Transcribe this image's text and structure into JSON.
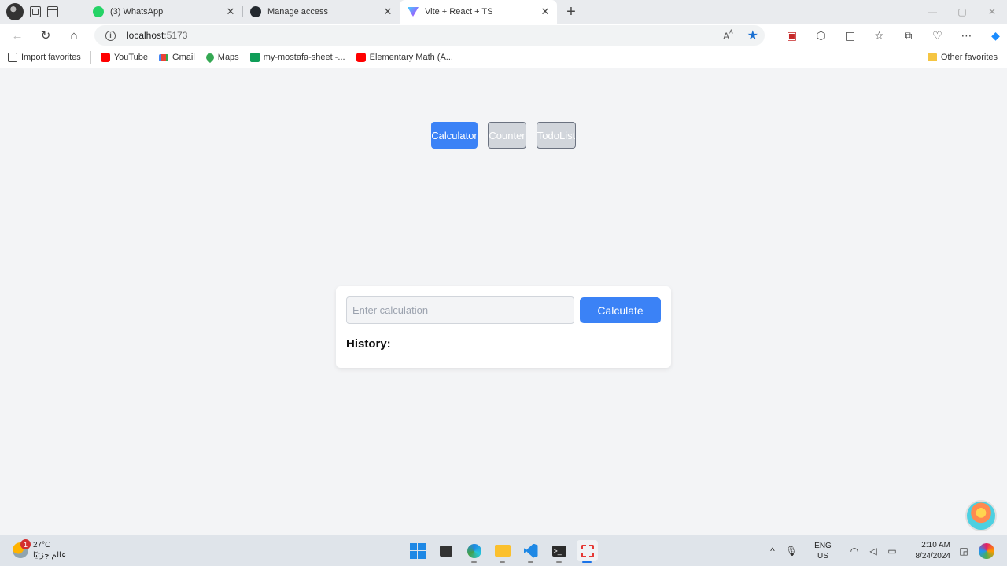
{
  "browser": {
    "tabs": [
      {
        "title": "(3) WhatsApp",
        "icon": "whatsapp-icon",
        "active": false
      },
      {
        "title": "Manage access",
        "icon": "github-icon",
        "active": false
      },
      {
        "title": "Vite + React + TS",
        "icon": "vite-icon",
        "active": true
      }
    ],
    "address": {
      "host": "localhost",
      "port": ":5173"
    },
    "bookmarks": [
      {
        "label": "Import favorites",
        "icon": "import-icon"
      },
      {
        "label": "YouTube",
        "icon": "youtube-icon"
      },
      {
        "label": "Gmail",
        "icon": "gmail-icon"
      },
      {
        "label": "Maps",
        "icon": "maps-icon"
      },
      {
        "label": "my-mostafa-sheet -...",
        "icon": "sheets-icon"
      },
      {
        "label": "Elementary Math (A...",
        "icon": "youtube-icon"
      }
    ],
    "other_favorites": "Other favorites"
  },
  "app": {
    "nav": [
      {
        "label": "Calculator",
        "active": true
      },
      {
        "label": "Counter",
        "active": false
      },
      {
        "label": "TodoList",
        "active": false
      }
    ],
    "calculator": {
      "input_value": "",
      "input_placeholder": "Enter calculation",
      "button_label": "Calculate",
      "history_label": "History:"
    },
    "colors": {
      "accent": "#3b82f6",
      "inactive": "#d1d5db"
    }
  },
  "taskbar": {
    "weather": {
      "temp": "27°C",
      "desc": "عالم جزئيًا",
      "badge": "1"
    },
    "language": {
      "lang": "ENG",
      "region": "US"
    },
    "clock": {
      "time": "2:10 AM",
      "date": "8/24/2024"
    }
  }
}
